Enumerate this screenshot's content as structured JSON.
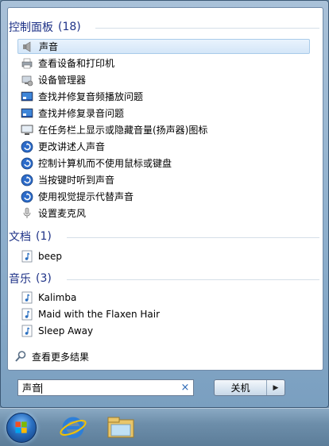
{
  "control_panel": {
    "header": "控制面板",
    "count": "(18)",
    "items": [
      {
        "label": "声音",
        "icon": "speaker-icon",
        "selected": true
      },
      {
        "label": "查看设备和打印机",
        "icon": "printer-icon"
      },
      {
        "label": "设备管理器",
        "icon": "device-manager-icon"
      },
      {
        "label": "查找并修复音频播放问题",
        "icon": "troubleshoot-icon"
      },
      {
        "label": "查找并修复录音问题",
        "icon": "troubleshoot-icon"
      },
      {
        "label": "在任务栏上显示或隐藏音量(扬声器)图标",
        "icon": "monitor-icon"
      },
      {
        "label": "更改讲述人声音",
        "icon": "ease-of-access-icon"
      },
      {
        "label": "控制计算机而不使用鼠标或键盘",
        "icon": "ease-of-access-icon"
      },
      {
        "label": "当按键时听到声音",
        "icon": "ease-of-access-icon"
      },
      {
        "label": "使用视觉提示代替声音",
        "icon": "ease-of-access-icon"
      },
      {
        "label": "设置麦克风",
        "icon": "microphone-icon"
      }
    ]
  },
  "documents": {
    "header": "文档",
    "count": "(1)",
    "items": [
      {
        "label": "beep",
        "icon": "music-file-icon"
      }
    ]
  },
  "music": {
    "header": "音乐",
    "count": "(3)",
    "items": [
      {
        "label": "Kalimba",
        "icon": "music-file-icon"
      },
      {
        "label": "Maid with the Flaxen Hair",
        "icon": "music-file-icon"
      },
      {
        "label": "Sleep Away",
        "icon": "music-file-icon"
      }
    ]
  },
  "see_more": "查看更多结果",
  "search": {
    "value": "声音",
    "clear_icon": "×"
  },
  "shutdown": {
    "label": "关机",
    "arrow": "▶"
  },
  "taskbar": {
    "items": [
      "start-orb",
      "internet-explorer-icon",
      "windows-explorer-icon"
    ]
  }
}
